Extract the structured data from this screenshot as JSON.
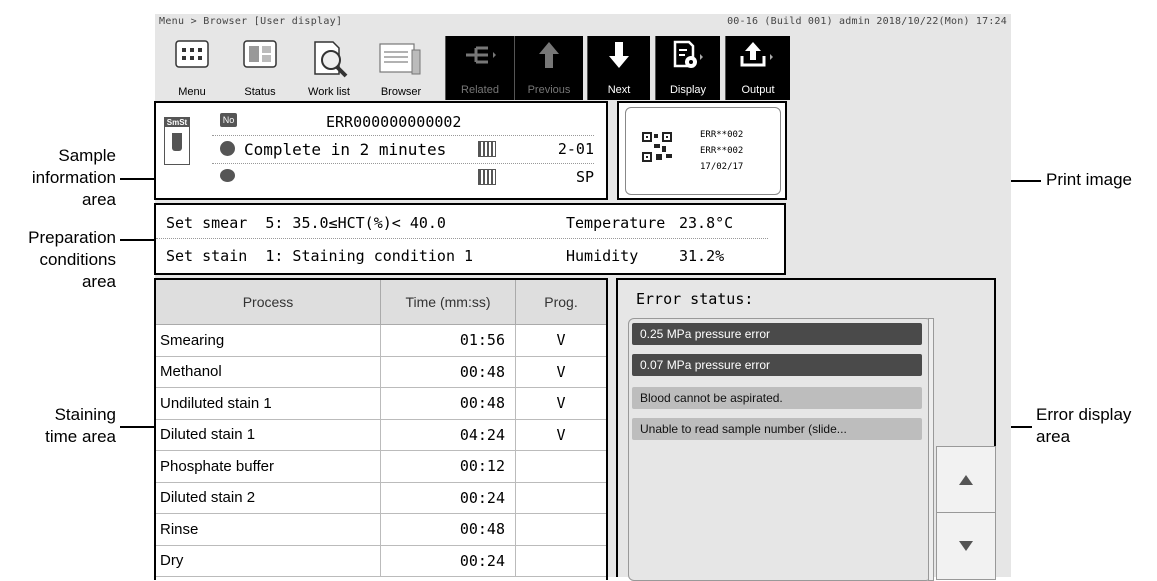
{
  "breadcrumb": "Menu > Browser [User display]",
  "status_line": "00-16 (Build 001) admin 2018/10/22(Mon) 17:24",
  "toolbar": {
    "menu": "Menu",
    "status": "Status",
    "worklist": "Work list",
    "browser": "Browser",
    "related": "Related",
    "previous": "Previous",
    "next": "Next",
    "display": "Display",
    "output": "Output"
  },
  "sample": {
    "badge": "SmSt",
    "no_icon": "No",
    "number": "ERR000000000002",
    "complete": "Complete in 2 minutes",
    "rack1": "2-01",
    "rack2": "SP"
  },
  "print": {
    "line1": "ERR**002",
    "line2": "ERR**002",
    "line3": "17/02/17"
  },
  "prep": {
    "smear": "Set smear  5: 35.0≤HCT(%)< 40.0",
    "temp_label": "Temperature",
    "temp_value": "23.8°C",
    "stain": "Set stain  1: Staining condition 1",
    "hum_label": "Humidity",
    "hum_value": "31.2%"
  },
  "table": {
    "headers": [
      "Process",
      "Time (mm:ss)",
      "Prog."
    ],
    "rows": [
      {
        "process": "Smearing",
        "time": "01:56",
        "prog": "V"
      },
      {
        "process": "Methanol",
        "time": "00:48",
        "prog": "V"
      },
      {
        "process": "Undiluted stain 1",
        "time": "00:48",
        "prog": "V"
      },
      {
        "process": "Diluted stain 1",
        "time": "04:24",
        "prog": "V"
      },
      {
        "process": "Phosphate buffer",
        "time": "00:12",
        "prog": ""
      },
      {
        "process": "Diluted stain 2",
        "time": "00:24",
        "prog": ""
      },
      {
        "process": "Rinse",
        "time": "00:48",
        "prog": ""
      },
      {
        "process": "Dry",
        "time": "00:24",
        "prog": ""
      }
    ]
  },
  "errors": {
    "title": "Error status:",
    "items": [
      "0.25 MPa pressure error",
      "0.07 MPa pressure error",
      "Blood cannot be aspirated.",
      "Unable to read sample number (slide..."
    ]
  },
  "callouts": {
    "sample_area": "Sample\ninformation\narea",
    "prep_area": "Preparation\nconditions\narea",
    "stain_area": "Staining\ntime area",
    "print_image": "Print image",
    "error_area": "Error display\narea"
  }
}
